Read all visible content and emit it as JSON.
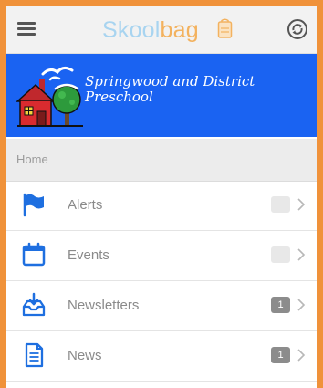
{
  "header": {
    "logo_part1": "Skool",
    "logo_part2": "bag",
    "menu_icon": "hamburger-menu-icon",
    "sync_icon": "sync-icon"
  },
  "banner": {
    "school_name": "Springwood and District Preschool",
    "background_color": "#1a63f2"
  },
  "breadcrumb": {
    "label": "Home"
  },
  "menu": {
    "items": [
      {
        "label": "Alerts",
        "icon": "flag-icon",
        "badge": "",
        "badge_style": "light"
      },
      {
        "label": "Events",
        "icon": "calendar-icon",
        "badge": "",
        "badge_style": "light"
      },
      {
        "label": "Newsletters",
        "icon": "inbox-download-icon",
        "badge": "1",
        "badge_style": "dark"
      },
      {
        "label": "News",
        "icon": "document-icon",
        "badge": "1",
        "badge_style": "dark"
      }
    ]
  },
  "colors": {
    "frame_border": "#f0923a",
    "icon_blue": "#1e6fe0",
    "badge_dark": "#8c8c8c",
    "badge_light": "#e8e8e8"
  }
}
